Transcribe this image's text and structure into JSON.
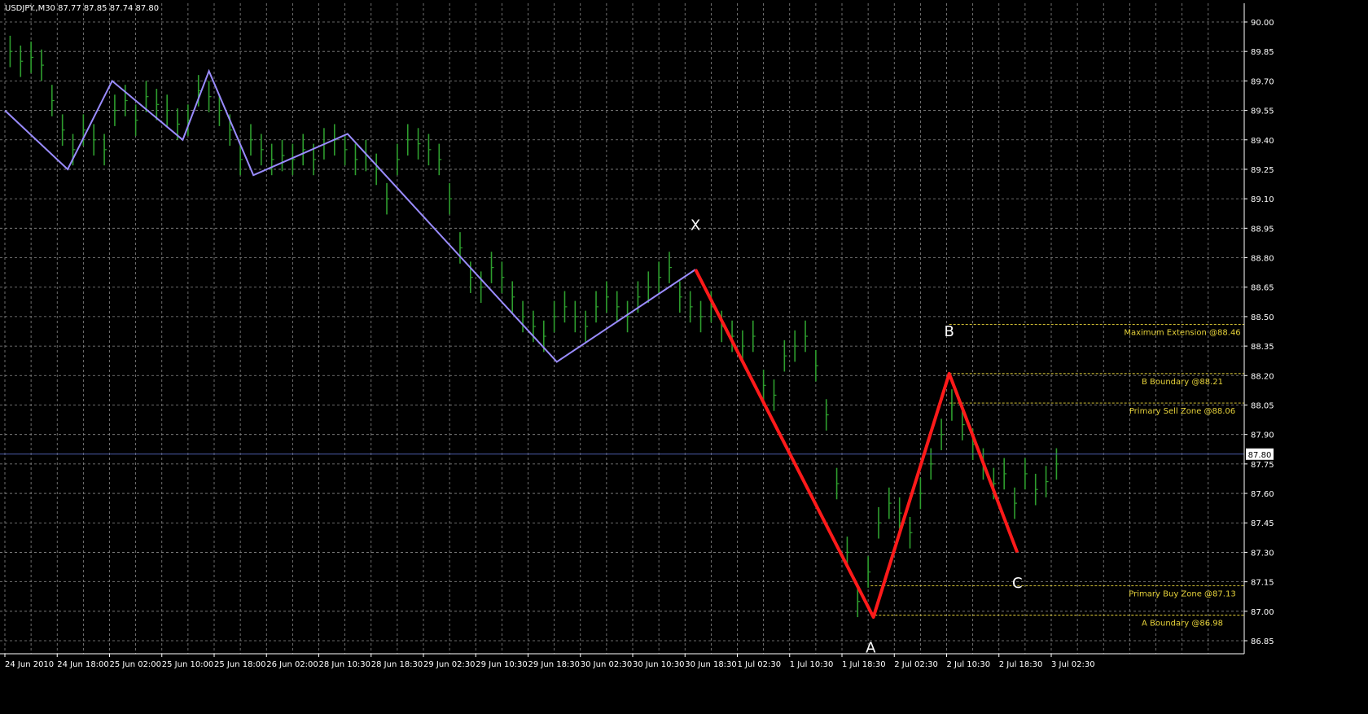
{
  "header": {
    "symbol_text": "USDJPY.,M30  87.77 87.85 87.74 87.80"
  },
  "colors": {
    "background": "#000000",
    "grid": "#8a8a8a",
    "price_bars": "#2e9e2e",
    "zigzag": "#9a8cff",
    "pattern": "#ff1a1a",
    "level": "#e6d23a",
    "current_price_line": "#4a5aa8"
  },
  "chart_data": {
    "type": "line",
    "title": "USDJPY.,M30",
    "ohlc_last": {
      "open": 87.77,
      "high": 87.85,
      "low": 87.74,
      "close": 87.8
    },
    "ylim": [
      86.85,
      90.0
    ],
    "y_ticks": [
      90.0,
      89.85,
      89.7,
      89.55,
      89.4,
      89.25,
      89.1,
      88.95,
      88.8,
      88.65,
      88.5,
      88.35,
      88.2,
      88.05,
      87.9,
      87.75,
      87.6,
      87.45,
      87.3,
      87.15,
      87.0,
      86.85
    ],
    "y_tick_labels": [
      "90.00",
      "89.85",
      "89.70",
      "89.55",
      "89.40",
      "89.25",
      "89.10",
      "88.95",
      "88.80",
      "88.65",
      "88.50",
      "88.35",
      "88.20",
      "88.05",
      "87.90",
      "87.75",
      "87.60",
      "87.45",
      "87.30",
      "87.15",
      "87.00",
      "86.85"
    ],
    "x_tick_labels": [
      "24 Jun 2010",
      "24 Jun 18:00",
      "25 Jun 02:00",
      "25 Jun 10:00",
      "25 Jun 18:00",
      "26 Jun 02:00",
      "28 Jun 10:30",
      "28 Jun 18:30",
      "29 Jun 02:30",
      "29 Jun 10:30",
      "29 Jun 18:30",
      "30 Jun 02:30",
      "30 Jun 10:30",
      "30 Jun 18:30",
      "1 Jul 02:30",
      "1 Jul 10:30",
      "1 Jul 18:30",
      "2 Jul 02:30",
      "2 Jul 10:30",
      "2 Jul 18:30",
      "3 Jul 02:30"
    ],
    "grid": true,
    "current_price": {
      "value": 87.8,
      "label": "87.80"
    },
    "series": [
      {
        "name": "ZigZag",
        "x_index": [
          0,
          1.2,
          2.05,
          3.4,
          3.9,
          4.75,
          6.55,
          10.55,
          13.2
        ],
        "values": [
          89.55,
          89.25,
          89.7,
          89.4,
          89.75,
          89.22,
          89.43,
          88.27,
          88.74
        ]
      },
      {
        "name": "XABC pattern",
        "x_index": [
          13.2,
          16.6,
          18.05,
          19.35
        ],
        "values": [
          88.74,
          86.97,
          88.21,
          87.3
        ]
      },
      {
        "name": "Price bars",
        "x_index": [
          0.1,
          0.3,
          0.5,
          0.7,
          0.9,
          1.1,
          1.3,
          1.5,
          1.7,
          1.9,
          2.1,
          2.3,
          2.5,
          2.7,
          2.9,
          3.1,
          3.3,
          3.5,
          3.7,
          3.9,
          4.1,
          4.3,
          4.5,
          4.7,
          4.9,
          5.1,
          5.3,
          5.5,
          5.7,
          5.9,
          6.1,
          6.3,
          6.5,
          6.7,
          6.9,
          7.1,
          7.3,
          7.5,
          7.7,
          7.9,
          8.1,
          8.3,
          8.5,
          8.7,
          8.9,
          9.1,
          9.3,
          9.5,
          9.7,
          9.9,
          10.1,
          10.3,
          10.5,
          10.7,
          10.9,
          11.1,
          11.3,
          11.5,
          11.7,
          11.9,
          12.1,
          12.3,
          12.5,
          12.7,
          12.9,
          13.1,
          13.3,
          13.5,
          13.7,
          13.9,
          14.1,
          14.3,
          14.5,
          14.7,
          14.9,
          15.1,
          15.3,
          15.5,
          15.7,
          15.9,
          16.1,
          16.3,
          16.5,
          16.7,
          16.9,
          17.1,
          17.3,
          17.5,
          17.7,
          17.9,
          18.1,
          18.3,
          18.5,
          18.7,
          18.9,
          19.1,
          19.3,
          19.5,
          19.7,
          19.9,
          20.1
        ],
        "values": [
          89.85,
          89.8,
          89.82,
          89.78,
          89.6,
          89.45,
          89.35,
          89.45,
          89.4,
          89.35,
          89.55,
          89.6,
          89.5,
          89.62,
          89.58,
          89.55,
          89.48,
          89.5,
          89.65,
          89.62,
          89.55,
          89.45,
          89.3,
          89.4,
          89.35,
          89.3,
          89.32,
          89.3,
          89.35,
          89.3,
          89.38,
          89.4,
          89.35,
          89.3,
          89.32,
          89.25,
          89.1,
          89.3,
          89.4,
          89.38,
          89.35,
          89.3,
          89.1,
          88.85,
          88.7,
          88.65,
          88.75,
          88.7,
          88.6,
          88.5,
          88.45,
          88.4,
          88.5,
          88.55,
          88.5,
          88.45,
          88.55,
          88.6,
          88.55,
          88.5,
          88.6,
          88.65,
          88.7,
          88.75,
          88.6,
          88.55,
          88.5,
          88.55,
          88.45,
          88.4,
          88.35,
          88.4,
          88.15,
          88.1,
          88.3,
          88.35,
          88.4,
          88.25,
          88.0,
          87.65,
          87.3,
          87.05,
          87.2,
          87.45,
          87.55,
          87.5,
          87.4,
          87.6,
          87.75,
          87.9,
          88.05,
          87.95,
          87.85,
          87.75,
          87.65,
          87.7,
          87.55,
          87.7,
          87.62,
          87.66,
          87.75
        ]
      }
    ],
    "annotations": [
      {
        "text": "X",
        "x_index": 13.2,
        "y": 88.94
      },
      {
        "text": "A",
        "x_index": 16.55,
        "y": 86.79
      },
      {
        "text": "B",
        "x_index": 18.05,
        "y": 88.4
      },
      {
        "text": "C",
        "x_index": 19.35,
        "y": 87.12
      }
    ],
    "levels": [
      {
        "label": "Maximum Extension @88.46",
        "value": 88.46,
        "x_start_index": 18.05
      },
      {
        "label": "B Boundary @88.21",
        "value": 88.21,
        "x_start_index": 18.05
      },
      {
        "label": "Primary Sell Zone @88.06",
        "value": 88.06,
        "x_start_index": 18.05
      },
      {
        "label": "Primary Buy Zone @87.13",
        "value": 87.13,
        "x_start_index": 16.55
      },
      {
        "label": "A Boundary @86.98",
        "value": 86.98,
        "x_start_index": 16.55
      }
    ]
  }
}
